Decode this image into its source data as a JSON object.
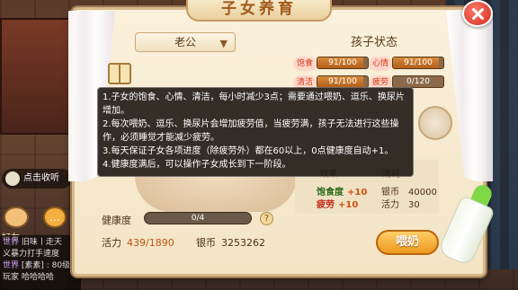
{
  "background": {
    "side_button": "点击收听",
    "friends_label": "好友",
    "chat_lines": [
      {
        "tag": "世界",
        "text": "旧味丨走天"
      },
      {
        "tag": "",
        "text": "义暴力打手速度"
      },
      {
        "tag": "世界",
        "text": "[素素] : 80级以上一起"
      },
      {
        "tag": "",
        "text": "玩家 哈哈哈哈"
      }
    ]
  },
  "dialog": {
    "title": "子女养育",
    "parent_select": "老公",
    "status_title": "孩子状态",
    "stats": [
      {
        "label": "饱食",
        "value": "91/100",
        "fraction": 0.91
      },
      {
        "label": "心情",
        "value": "91/100",
        "fraction": 0.91
      },
      {
        "label": "清洁",
        "value": "91/100",
        "fraction": 0.91
      },
      {
        "label": "疲劳",
        "value": "0/120",
        "fraction": 0.0
      }
    ],
    "tooltip_lines": [
      "1.子女的饱食、心情、清洁，每小时减少3点；需要通过喂奶、逗乐、换尿片增加。",
      "2.每次喂奶、逗乐、换尿片会增加疲劳值，当疲劳满，孩子无法进行这些操作，必须睡觉才能减少疲劳。",
      "3.每天保证子女各项进度（除疲劳外）都在60以上，0点健康度自动+1。",
      "4.健康度满后，可以操作子女成长到下一阶段。"
    ],
    "health": {
      "label": "健康度",
      "value": "0/4",
      "fraction": 0.0,
      "help": "?"
    },
    "vitality": {
      "label": "活力",
      "value": "439/1890"
    },
    "money": {
      "label": "银币",
      "value": "3253262"
    },
    "item": {
      "col_effect": "效果",
      "col_cost": "消耗",
      "effects": [
        {
          "key": "饱食度",
          "value": "+10"
        },
        {
          "key": "疲劳",
          "value": "+10"
        }
      ],
      "costs": [
        {
          "key": "银币",
          "value": "40000"
        },
        {
          "key": "活力",
          "value": "30"
        }
      ]
    },
    "feed_button": "喂奶"
  }
}
